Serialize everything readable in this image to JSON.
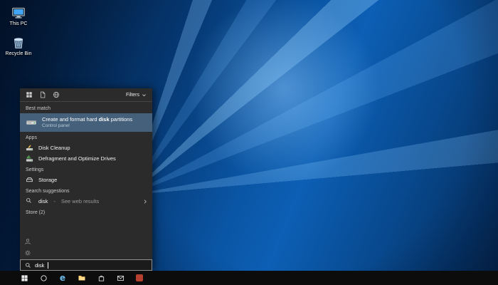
{
  "colors": {
    "accent": "#0078d7",
    "best_match_highlight": "#44607a",
    "panel_background": "#2b2b2b",
    "taskbar_background": "#0c0c0c"
  },
  "desktop": {
    "icons": [
      {
        "label": "This PC",
        "icon": "this-pc-icon"
      },
      {
        "label": "Recycle Bin",
        "icon": "recycle-bin-icon"
      }
    ]
  },
  "search_panel": {
    "filter_bar": {
      "tabs": [
        {
          "icon": "apps-filter-icon"
        },
        {
          "icon": "documents-filter-icon"
        },
        {
          "icon": "web-filter-icon"
        }
      ],
      "filters": {
        "label": "Filters",
        "icon": "chevron-down-icon"
      }
    },
    "best_match": {
      "header": "Best match",
      "title_prefix": "Create and format hard ",
      "title_match": "disk",
      "title_suffix": " partitions",
      "subtitle": "Control panel",
      "icon": "hard-disk-icon"
    },
    "apps": {
      "header": "Apps",
      "items": [
        {
          "label": "Disk Cleanup",
          "icon": "disk-cleanup-icon"
        },
        {
          "label": "Defragment and Optimize Drives",
          "icon": "defragment-icon"
        }
      ]
    },
    "settings": {
      "header": "Settings",
      "items": [
        {
          "label": "Storage",
          "icon": "storage-icon"
        }
      ]
    },
    "suggestions": {
      "header": "Search suggestions",
      "items": [
        {
          "term": "disk",
          "separator": "-",
          "detail": "See web results",
          "icon": "search-icon",
          "chevron": "chevron-right-icon"
        }
      ]
    },
    "store": {
      "header": "Store (2)"
    },
    "rail": {
      "icons": [
        "user-icon",
        "settings-gear-icon"
      ]
    },
    "search_box": {
      "value": "disk",
      "icon": "search-icon"
    }
  },
  "taskbar": {
    "items": [
      {
        "name": "start",
        "icon": "windows-logo-icon"
      },
      {
        "name": "cortana",
        "icon": "cortana-circle-icon"
      },
      {
        "name": "edge",
        "icon": "edge-icon",
        "glyph": "e"
      },
      {
        "name": "file-explorer",
        "icon": "folder-icon"
      },
      {
        "name": "store",
        "icon": "store-bag-icon"
      },
      {
        "name": "mail",
        "icon": "mail-envelope-icon"
      },
      {
        "name": "app",
        "icon": "red-app-icon"
      }
    ]
  }
}
